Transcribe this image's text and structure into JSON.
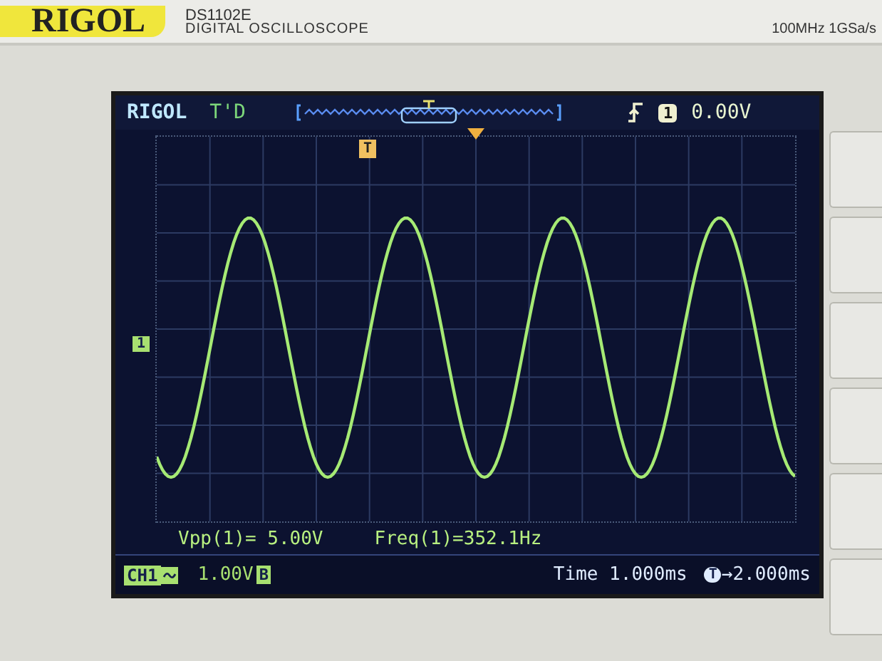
{
  "device": {
    "brand": "RIGOL",
    "model": "DS1102E",
    "subtitle": "DIGITAL OSCILLOSCOPE",
    "spec": "100MHz 1GSa/s"
  },
  "screen": {
    "logo": "RIGOL",
    "run_state": "T'D",
    "trigger": {
      "channel": "1",
      "level": "0.00V"
    },
    "trigger_marker": "T",
    "channel_marker": "1",
    "measurements": [
      "Vpp(1)= 5.00V",
      "Freq(1)=352.1Hz"
    ],
    "status_bar": {
      "channel": "CH1",
      "volts": "1.00V",
      "bandwidth_limit": "B",
      "timebase": "Time 1.000ms",
      "offset_badge": "T",
      "offset": "→2.000ms"
    }
  }
}
